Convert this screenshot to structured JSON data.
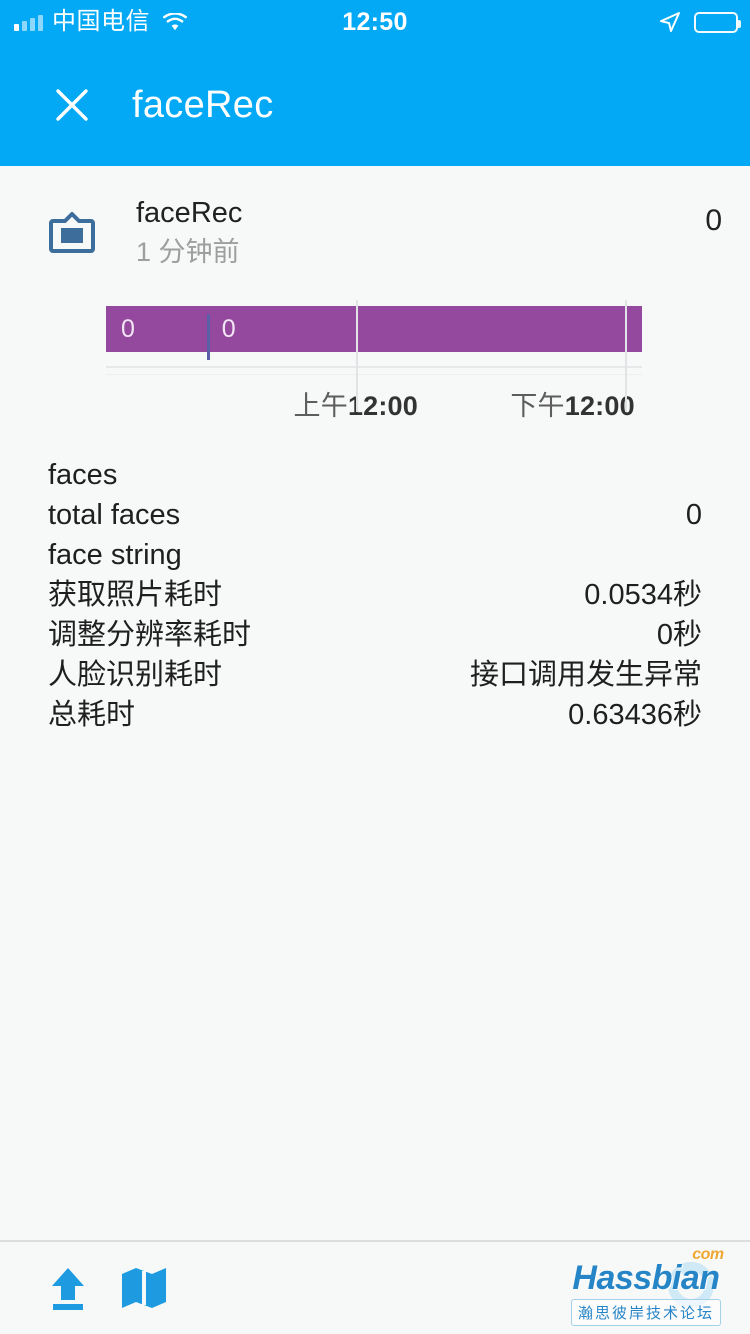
{
  "status_bar": {
    "carrier": "中国电信",
    "time": "12:50",
    "signal_icon": "signal-bars-icon",
    "wifi_icon": "wifi-icon",
    "location_icon": "location-arrow-icon",
    "battery_icon": "battery-full-icon"
  },
  "app_bar": {
    "close_icon": "close-icon",
    "title": "faceRec",
    "background_color": "#03a9f4"
  },
  "card": {
    "icon": "picture-frame-icon",
    "title": "faceRec",
    "subtitle": "1 分钟前",
    "value": "0"
  },
  "chart_data": {
    "type": "bar",
    "orientation": "horizontal",
    "title": "faceRec",
    "xlabel": "",
    "ylabel": "",
    "grid": true,
    "legend": "none",
    "bar_color": "#94499e",
    "divider_color": "#5b5fa8",
    "x_tick_labels": [
      "上午12:00",
      "下午12:00"
    ],
    "x_tick_positions_pct": [
      46.6,
      96.8
    ],
    "segments": [
      {
        "label": "0",
        "start_pct": 0,
        "end_pct": 18.8,
        "value": 0
      },
      {
        "label": "0",
        "start_pct": 18.8,
        "end_pct": 100,
        "value": 0
      }
    ],
    "values": [
      0,
      0
    ],
    "categories": [
      "上午12:00",
      "下午12:00"
    ]
  },
  "details": {
    "rows": [
      {
        "label": "faces",
        "value": ""
      },
      {
        "label": "total faces",
        "value": "0"
      },
      {
        "label": "face string",
        "value": ""
      },
      {
        "label": "获取照片耗时",
        "value": "0.0534秒"
      },
      {
        "label": "调整分辨率耗时",
        "value": "0秒"
      },
      {
        "label": "人脸识别耗时",
        "value": "接口调用发生异常"
      },
      {
        "label": "总耗时",
        "value": "0.63436秒"
      }
    ]
  },
  "bottom_bar": {
    "upload_icon": "upload-icon",
    "map_icon": "map-icon",
    "accent_color": "#1e9be0"
  },
  "watermark": {
    "brand": "Hassbian",
    "tld": "com",
    "subtitle": "瀚思彼岸技术论坛"
  }
}
